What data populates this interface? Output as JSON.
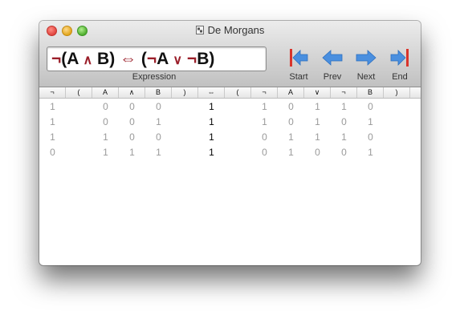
{
  "window": {
    "title": "De Morgans"
  },
  "expression": {
    "value": "¬(A ∧ B) ⇔ (¬A ∨ ¬B)",
    "label": "Expression"
  },
  "nav": {
    "start_label": "Start",
    "prev_label": "Prev",
    "next_label": "Next",
    "end_label": "End"
  },
  "colors": {
    "operator": "#9b1f2a",
    "nav_arrow": "#4a8fdf",
    "nav_bar": "#d9342b",
    "inactive_value": "#9a9a9a",
    "result_value": "#000000"
  },
  "table": {
    "columns": [
      "¬",
      "(",
      "A",
      "∧",
      "B",
      ")",
      "⇔",
      "(",
      "¬",
      "A",
      "∨",
      "¬",
      "B",
      ")"
    ],
    "main_column": 6,
    "rows": [
      [
        "1",
        "",
        "0",
        "0",
        "0",
        "",
        "1",
        "",
        "1",
        "0",
        "1",
        "1",
        "0",
        ""
      ],
      [
        "1",
        "",
        "0",
        "0",
        "1",
        "",
        "1",
        "",
        "1",
        "0",
        "1",
        "0",
        "1",
        ""
      ],
      [
        "1",
        "",
        "1",
        "0",
        "0",
        "",
        "1",
        "",
        "0",
        "1",
        "1",
        "1",
        "0",
        ""
      ],
      [
        "0",
        "",
        "1",
        "1",
        "1",
        "",
        "1",
        "",
        "0",
        "1",
        "0",
        "0",
        "1",
        ""
      ]
    ]
  }
}
